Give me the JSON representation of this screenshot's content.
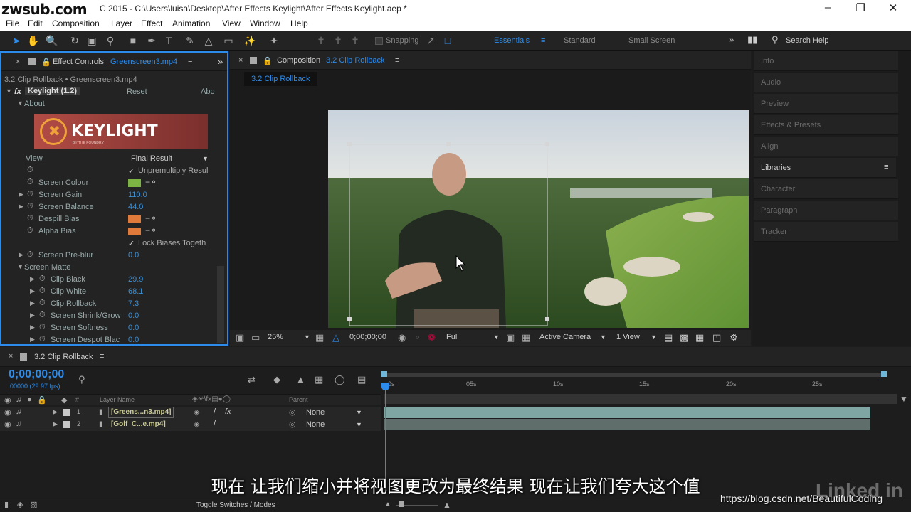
{
  "title_bar": {
    "watermark": "zwsub.com",
    "title": "C 2015 - C:\\Users\\luisa\\Desktop\\After Effects Keylight\\After Effects Keylight.aep *"
  },
  "menu": [
    "File",
    "Edit",
    "Composition",
    "Layer",
    "Effect",
    "Animation",
    "View",
    "Window",
    "Help"
  ],
  "toolbar": {
    "snapping_label": "Snapping",
    "workspaces": [
      "Essentials",
      "Standard",
      "Small Screen"
    ],
    "active_workspace": "Essentials",
    "search_help": "Search Help"
  },
  "effect_controls": {
    "tab_label": "Effect Controls",
    "tab_file": "Greenscreen3.mp4",
    "breadcrumb": "3.2 Clip Rollback • Greenscreen3.mp4",
    "effect_name": "Keylight (1.2)",
    "reset_label": "Reset",
    "about_link": "Abo",
    "about_label": "About",
    "logo_text": "KEYLIGHT",
    "logo_sub": "BY THE FOUNDRY",
    "view_label": "View",
    "view_value": "Final Result",
    "unpremultiply": "Unpremultiply Resul",
    "lock_biases": "Lock Biases Togeth",
    "params": [
      {
        "label": "Screen Colour",
        "value": ""
      },
      {
        "label": "Screen Gain",
        "value": "110.0"
      },
      {
        "label": "Screen Balance",
        "value": "44.0"
      },
      {
        "label": "Despill Bias",
        "value": ""
      },
      {
        "label": "Alpha Bias",
        "value": ""
      },
      {
        "label": "Screen Pre-blur",
        "value": "0.0"
      },
      {
        "label": "Screen Matte",
        "value": ""
      },
      {
        "label": "Clip Black",
        "value": "29.9"
      },
      {
        "label": "Clip White",
        "value": "68.1"
      },
      {
        "label": "Clip Rollback",
        "value": "7.3"
      },
      {
        "label": "Screen Shrink/Grow",
        "value": "0.0"
      },
      {
        "label": "Screen Softness",
        "value": "0.0"
      },
      {
        "label": "Screen Despot Blac",
        "value": "0.0"
      }
    ],
    "colors": {
      "screen_colour": "#7cb342",
      "despill": "#e07a3a",
      "alpha": "#e07a3a"
    }
  },
  "composition": {
    "tab_label": "Composition",
    "tab_name": "3.2 Clip Rollback",
    "sub_tab": "3.2 Clip Rollback",
    "zoom": "25%",
    "timecode": "0;00;00;00",
    "resolution": "Full",
    "camera": "Active Camera",
    "views": "1 View"
  },
  "right_panels": [
    "Info",
    "Audio",
    "Preview",
    "Effects & Presets",
    "Align",
    "Libraries",
    "Character",
    "Paragraph",
    "Tracker"
  ],
  "right_active": "Libraries",
  "timeline": {
    "tab": "3.2 Clip Rollback",
    "timecode": "0;00;00;00",
    "frame_info": "00000 (29.97 fps)",
    "col_num": "#",
    "col_layer": "Layer Name",
    "col_parent": "Parent",
    "ruler": [
      "0s",
      "05s",
      "10s",
      "15s",
      "20s",
      "25s"
    ],
    "layers": [
      {
        "num": "1",
        "name": "[Greens...n3.mp4]",
        "parent": "None"
      },
      {
        "num": "2",
        "name": "[Golf_C...e.mp4]",
        "parent": "None"
      }
    ],
    "toggle_label": "Toggle Switches / Modes"
  },
  "overlay": {
    "subtitle": "现在  让我们缩小并将视图更改为最终结果  现在让我们夸大这个值",
    "csdn": "https://blog.csdn.net/BeautifulCoding",
    "linkedin": "Linked in"
  }
}
